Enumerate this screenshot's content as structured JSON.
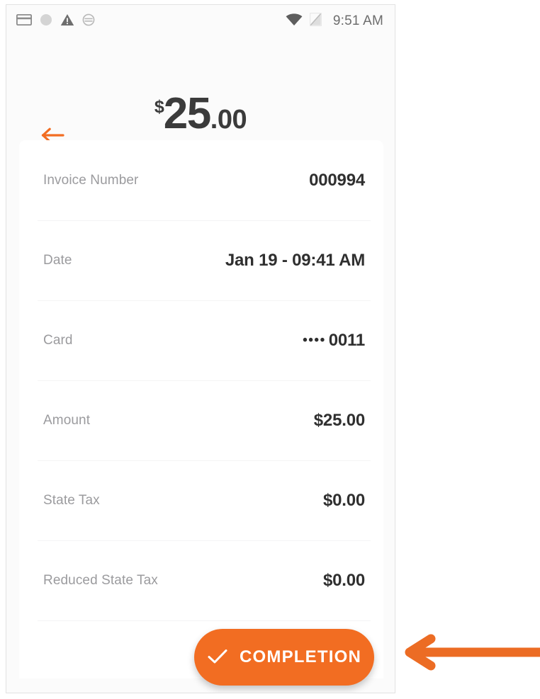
{
  "colors": {
    "accent": "#f26d22",
    "frame_border": "#e2e2e2",
    "card_bg": "#ffffff",
    "screen_bg": "#fbfbfb",
    "label_text": "#9b9b9e",
    "value_text": "#2f2f2f"
  },
  "status_bar": {
    "clock": "9:51 AM",
    "left_icons": [
      {
        "name": "credit-card-icon"
      },
      {
        "name": "circle-icon"
      },
      {
        "name": "warning-triangle-icon"
      },
      {
        "name": "sync-disabled-icon"
      }
    ],
    "right_icons": [
      {
        "name": "wifi-icon"
      },
      {
        "name": "signal-off-icon"
      }
    ]
  },
  "header": {
    "back_label": "Back",
    "amount_currency": "$",
    "amount_whole": "25",
    "amount_cents": ".00"
  },
  "details": {
    "rows": [
      {
        "label": "Invoice Number",
        "value": "000994",
        "masked": false
      },
      {
        "label": "Date",
        "value": "Jan 19 - 09:41 AM",
        "masked": false
      },
      {
        "label": "Card",
        "value": "0011",
        "masked": true,
        "mask": "••••"
      },
      {
        "label": "Amount",
        "value": "$25.00",
        "masked": false
      },
      {
        "label": "State Tax",
        "value": "$0.00",
        "masked": false
      },
      {
        "label": "Reduced State Tax",
        "value": "$0.00",
        "masked": false
      },
      {
        "label": "",
        "value": "",
        "masked": false
      }
    ]
  },
  "completion": {
    "label": "COMPLETION",
    "icon": "check-icon"
  },
  "annotation": {
    "arrow": "left-pointing-arrow",
    "target": "completion-button"
  }
}
